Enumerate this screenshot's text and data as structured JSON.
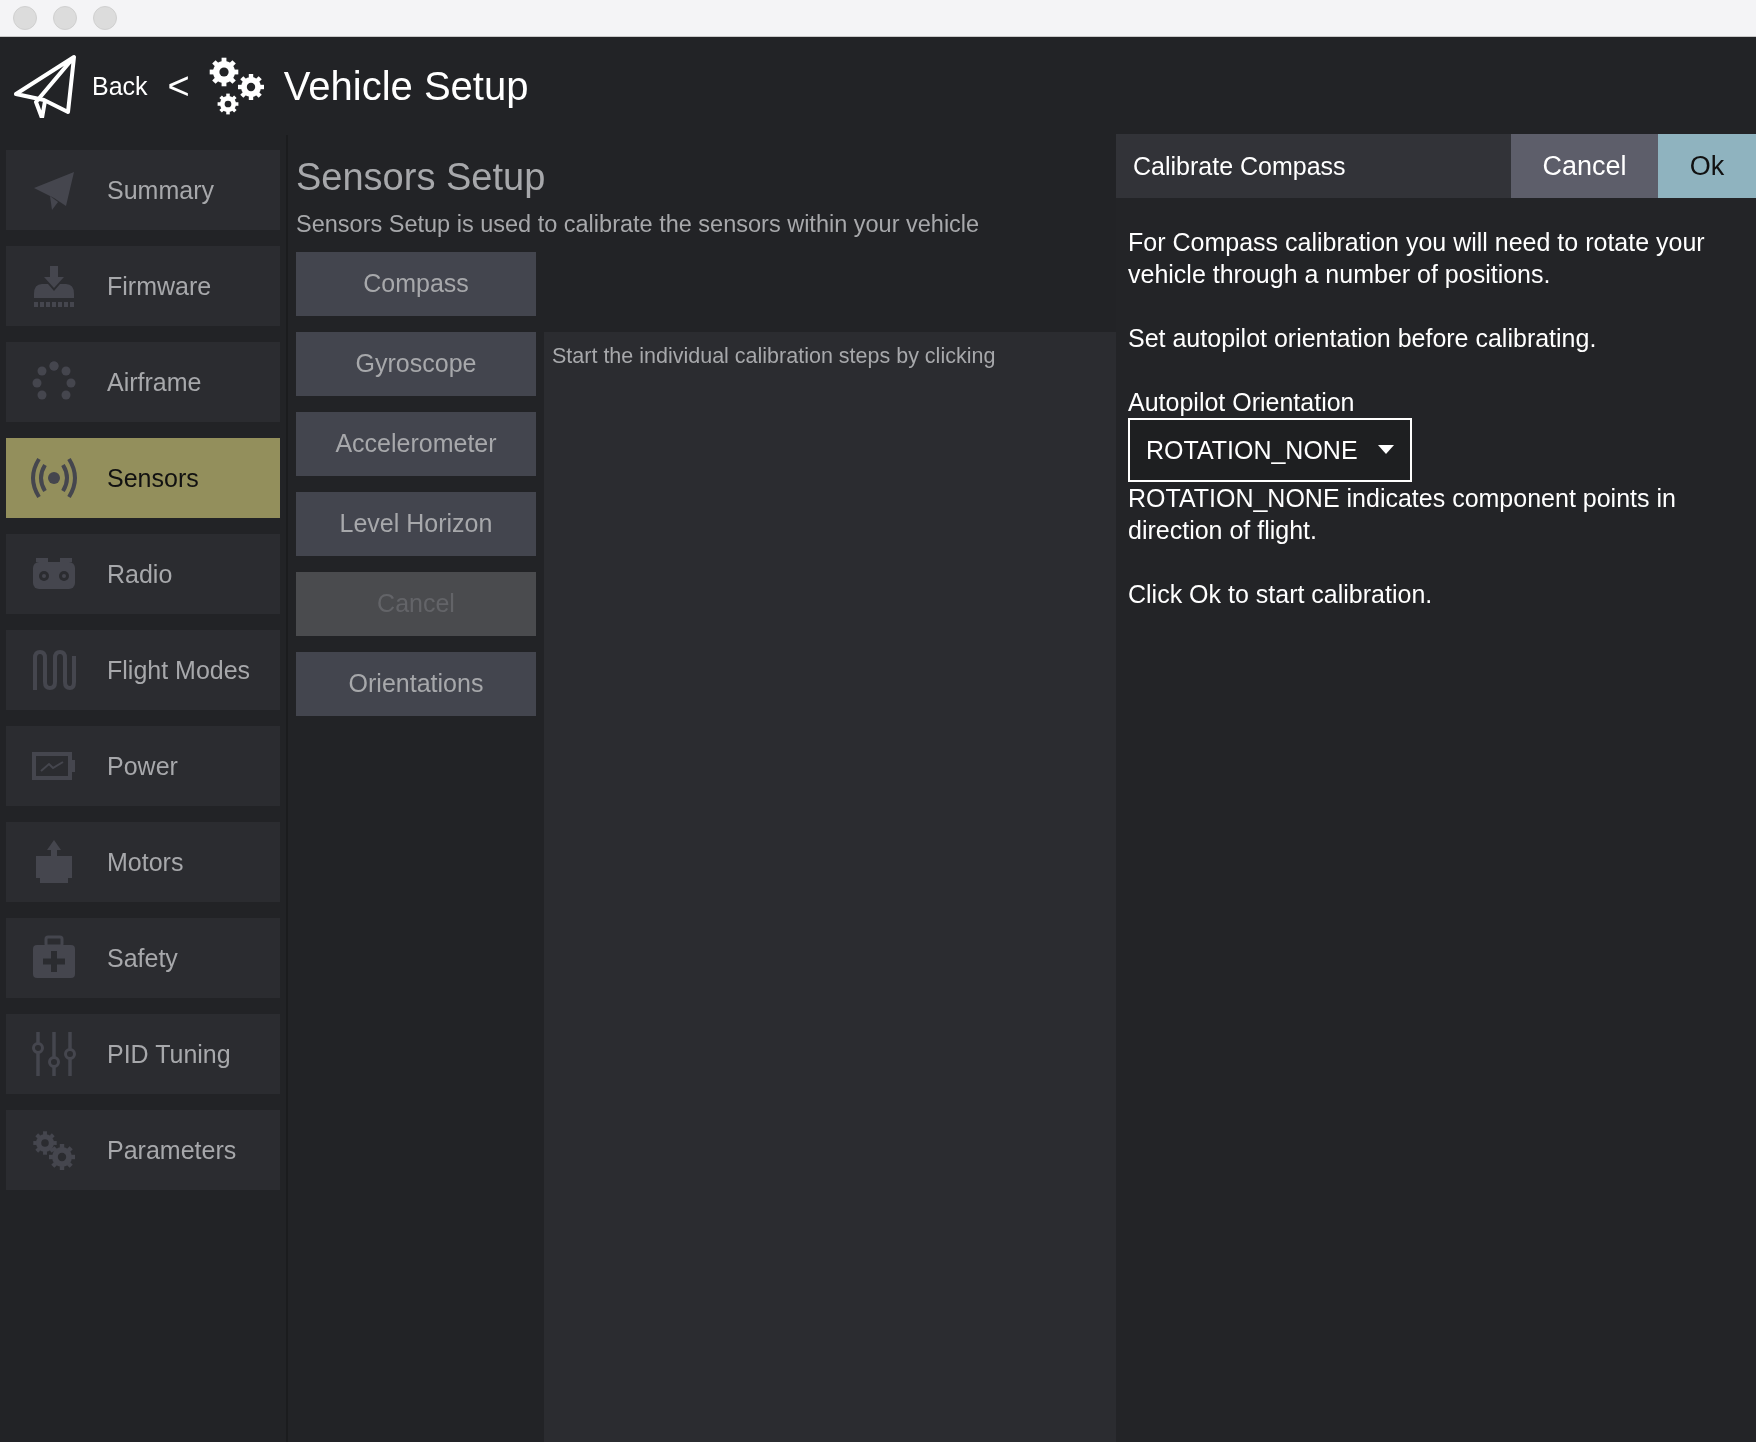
{
  "header": {
    "back": "Back",
    "separator": "<",
    "title": "Vehicle Setup"
  },
  "sidebar": {
    "items": [
      {
        "label": "Summary",
        "selected": false
      },
      {
        "label": "Firmware",
        "selected": false
      },
      {
        "label": "Airframe",
        "selected": false
      },
      {
        "label": "Sensors",
        "selected": true
      },
      {
        "label": "Radio",
        "selected": false
      },
      {
        "label": "Flight Modes",
        "selected": false
      },
      {
        "label": "Power",
        "selected": false
      },
      {
        "label": "Motors",
        "selected": false
      },
      {
        "label": "Safety",
        "selected": false
      },
      {
        "label": "PID Tuning",
        "selected": false
      },
      {
        "label": "Parameters",
        "selected": false
      }
    ]
  },
  "page": {
    "title": "Sensors Setup",
    "description": "Sensors Setup is used to calibrate the sensors within your vehicle",
    "buttons": [
      {
        "label": "Compass",
        "disabled": false
      },
      {
        "label": "Gyroscope",
        "disabled": false
      },
      {
        "label": "Accelerometer",
        "disabled": false
      },
      {
        "label": "Level Horizon",
        "disabled": false
      },
      {
        "label": "Cancel",
        "disabled": true
      },
      {
        "label": "Orientations",
        "disabled": false
      }
    ],
    "status": "Start the individual calibration steps by clicking"
  },
  "dialog": {
    "title": "Calibrate Compass",
    "buttons": [
      {
        "label": "Cancel",
        "kind": "secondary"
      },
      {
        "label": "Ok",
        "kind": "primary"
      }
    ],
    "intro": "For Compass calibration you will need to rotate your vehicle through a number of positions.",
    "instruction": "Set autopilot orientation before calibrating.",
    "orientation": {
      "label": "Autopilot Orientation",
      "value": "ROTATION_NONE"
    },
    "note": "ROTATION_NONE indicates component points in direction of flight.",
    "footer": "Click Ok to start calibration."
  }
}
